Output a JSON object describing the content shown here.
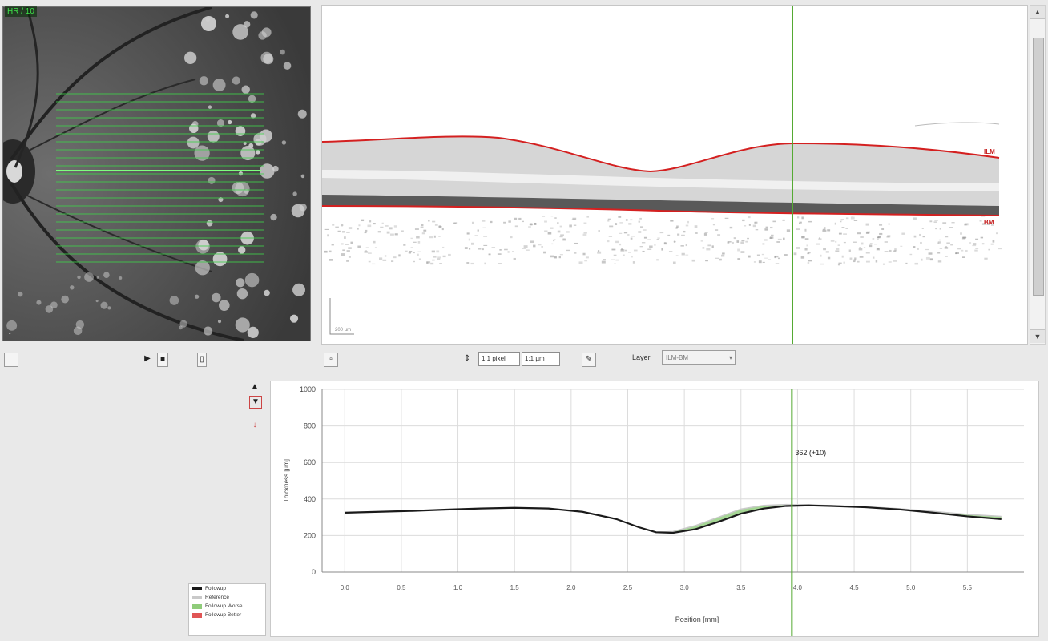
{
  "fundus": {
    "label": "HR / 10",
    "scan_line_count": 22
  },
  "bscan": {
    "layer_top_label": "ILM",
    "layer_bottom_label": "BM",
    "scale_label": "200 µm"
  },
  "toolbar": {
    "pixel_field": "1:1 pixel",
    "micron_field": "1:1 µm",
    "layer_label": "Layer",
    "layer_value": "ILM-BM"
  },
  "colors": {
    "followup": "#1a1a1a",
    "reference": "#c9c9c9",
    "followup_worse": "#8fcc7a",
    "followup_better": "#e05555",
    "cursor": "#55aa33",
    "layer_line": "#d42020"
  },
  "chart_data": {
    "type": "line",
    "xlabel": "Position [mm]",
    "ylabel": "Thickness [µm]",
    "xlim": [
      -0.2,
      6.0
    ],
    "ylim": [
      0,
      1000
    ],
    "yticks": [
      "0",
      "200",
      "400",
      "600",
      "800",
      "1000"
    ],
    "xtick_labels": [
      "0.0",
      "0.5",
      "1.0",
      "1.5",
      "2.0",
      "2.5",
      "3.0",
      "3.5",
      "4.0",
      "4.5",
      "5.0",
      "5.5"
    ],
    "cursor": {
      "x": 3.95,
      "label": "362 (+10)"
    },
    "series": [
      {
        "name": "Followup",
        "x": [
          0.0,
          0.3,
          0.6,
          0.9,
          1.2,
          1.5,
          1.8,
          2.1,
          2.4,
          2.6,
          2.75,
          2.9,
          3.1,
          3.3,
          3.5,
          3.7,
          3.9,
          4.1,
          4.3,
          4.6,
          4.9,
          5.2,
          5.5,
          5.8
        ],
        "y": [
          325,
          330,
          335,
          342,
          348,
          352,
          348,
          330,
          290,
          245,
          218,
          215,
          235,
          275,
          320,
          348,
          362,
          365,
          362,
          355,
          343,
          325,
          305,
          290
        ]
      },
      {
        "name": "Reference",
        "x": [
          0.0,
          0.3,
          0.6,
          0.9,
          1.2,
          1.5,
          1.8,
          2.1,
          2.4,
          2.6,
          2.75,
          2.9,
          3.1,
          3.3,
          3.5,
          3.7,
          3.9,
          4.1,
          4.3,
          4.6,
          4.9,
          5.2,
          5.5,
          5.8
        ],
        "y": [
          323,
          330,
          336,
          342,
          348,
          352,
          348,
          330,
          290,
          245,
          218,
          222,
          255,
          300,
          345,
          365,
          370,
          368,
          364,
          358,
          347,
          332,
          316,
          305
        ]
      }
    ],
    "legend": [
      "Followup",
      "Reference",
      "Followup Worse",
      "Followup Better"
    ]
  }
}
